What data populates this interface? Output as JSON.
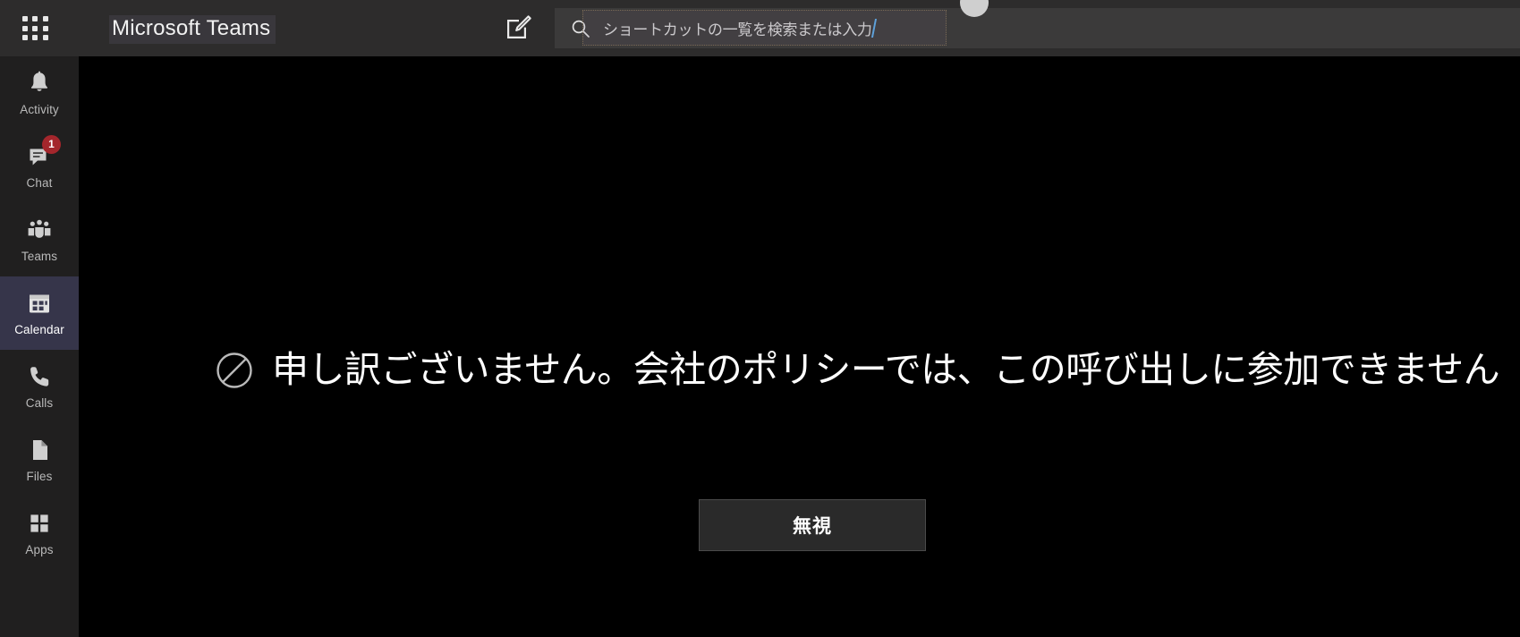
{
  "titlebar": {
    "app_title": "Microsoft Teams",
    "waffle_name": "app-launcher-icon",
    "compose_name": "compose-icon",
    "avatar_name": "user-avatar"
  },
  "search": {
    "placeholder": "ショートカットの一覧を検索または入力",
    "value": "/",
    "icon": "search-icon"
  },
  "rail": {
    "items": [
      {
        "label": "Activity",
        "icon": "bell-icon",
        "selected": false,
        "badge": null
      },
      {
        "label": "Chat",
        "icon": "chat-icon",
        "selected": false,
        "badge": "1"
      },
      {
        "label": "Teams",
        "icon": "teams-icon",
        "selected": false,
        "badge": null
      },
      {
        "label": "Calendar",
        "icon": "calendar-icon",
        "selected": true,
        "badge": null
      },
      {
        "label": "Calls",
        "icon": "phone-icon",
        "selected": false,
        "badge": null
      },
      {
        "label": "Files",
        "icon": "file-icon",
        "selected": false,
        "badge": null
      },
      {
        "label": "Apps",
        "icon": "apps-grid-icon",
        "selected": false,
        "badge": null
      }
    ]
  },
  "main": {
    "block_icon": "prohibition-icon",
    "message": "申し訳ございません。会社のポリシーでは、この呼び出しに参加できません",
    "ignore_label": "無視"
  },
  "colors": {
    "titlebar_bg": "#2d2c2c",
    "rail_bg": "#201f1f",
    "content_bg": "#000000",
    "selected_item_bg": "#36354a",
    "badge_bg": "#a4262c",
    "search_bg": "#3b3a3a",
    "text_primary": "#ffffff",
    "text_secondary": "#b9b9b9",
    "caret_accent": "#5aa9e6"
  }
}
